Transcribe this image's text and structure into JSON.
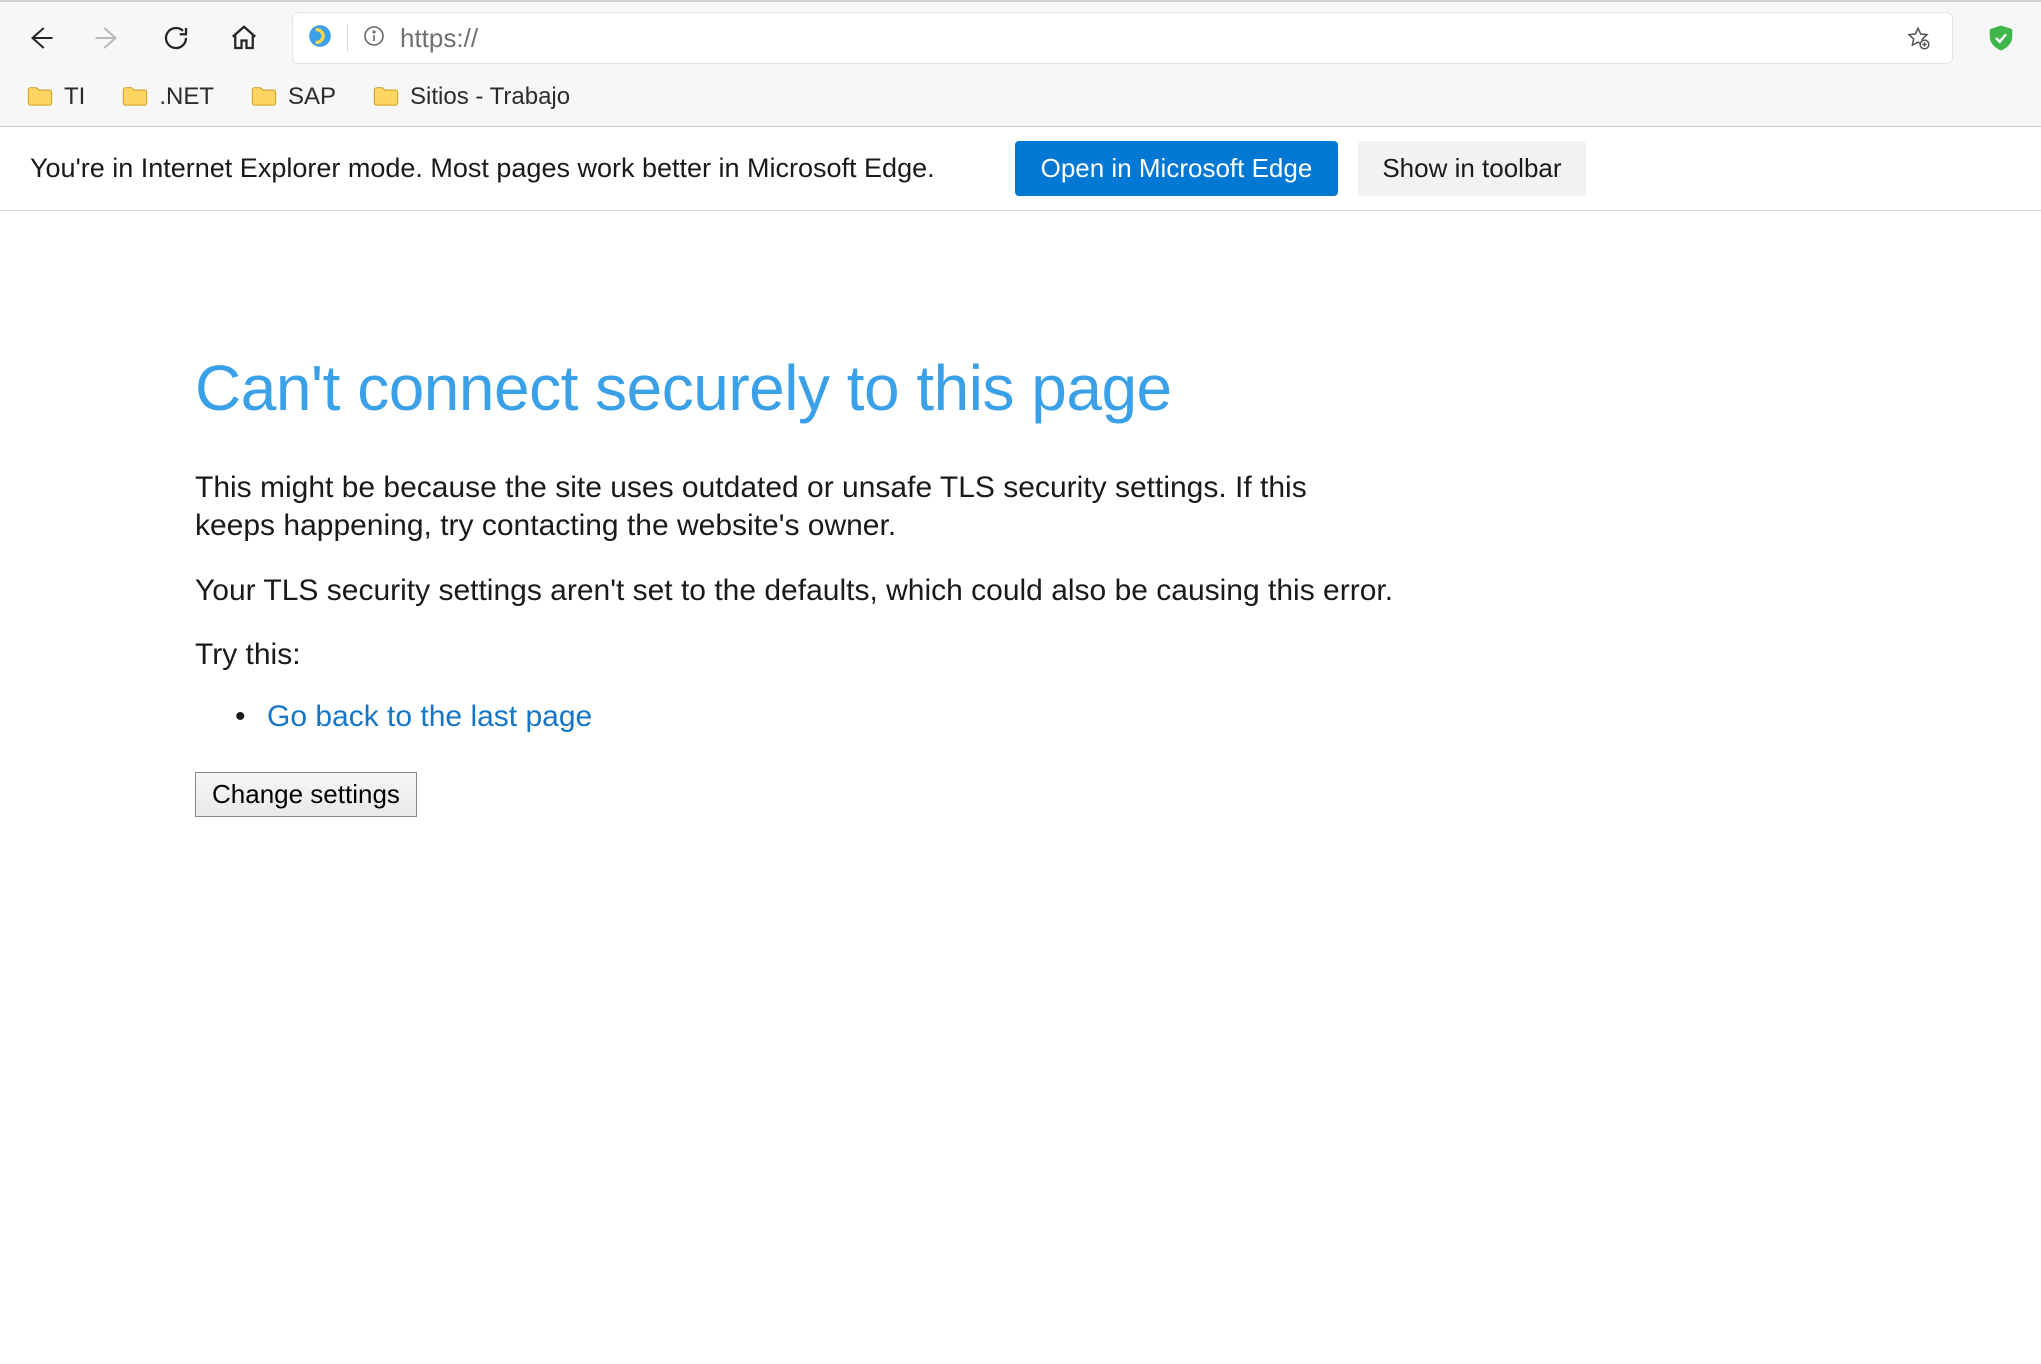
{
  "toolbar": {
    "url_value": "https://"
  },
  "bookmarks": [
    {
      "label": "TI"
    },
    {
      "label": ".NET"
    },
    {
      "label": "SAP"
    },
    {
      "label": "Sitios - Trabajo"
    }
  ],
  "ie_bar": {
    "message": "You're in Internet Explorer mode. Most pages work better in Microsoft Edge.",
    "open_edge_label": "Open in Microsoft Edge",
    "show_toolbar_label": "Show in toolbar"
  },
  "error": {
    "title": "Can't connect securely to this page",
    "paragraph1": "This might be because the site uses outdated or unsafe TLS security settings. If this keeps happening, try contacting the website's owner.",
    "paragraph2": "Your TLS security settings aren't set to the defaults, which could also be causing this error.",
    "try_this": "Try this:",
    "go_back_link": "Go back to the last page",
    "change_settings_label": "Change settings"
  }
}
